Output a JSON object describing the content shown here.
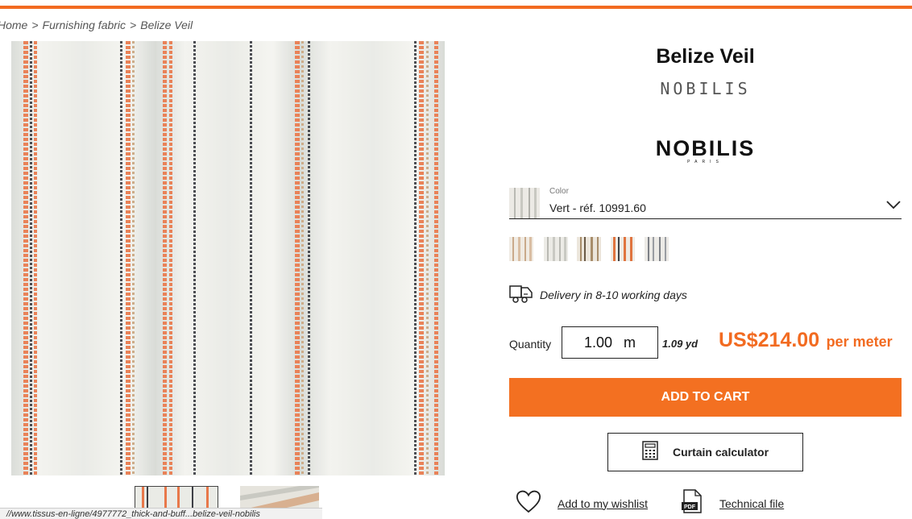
{
  "colors": {
    "accent": "#f26b21",
    "button": "#f37021",
    "price": "#f26b21"
  },
  "breadcrumb": {
    "items": [
      "Home",
      "Furnishing fabric",
      "Belize Veil"
    ],
    "separator": ">"
  },
  "product": {
    "title": "Belize Veil",
    "brand_subtitle": "NOBILIS",
    "brand_logo_name": "NOBILIS",
    "brand_logo_city": "PARIS"
  },
  "color_select": {
    "label": "Color",
    "value": "Vert - réf. 10991.60",
    "icon": "chevron-down-icon"
  },
  "swatches": [
    {
      "name": "beige",
      "stripe": "#c9a98a"
    },
    {
      "name": "vert",
      "stripe": "#b9b9b3"
    },
    {
      "name": "natural",
      "stripe": "#a88d6b"
    },
    {
      "name": "orange",
      "stripe": "#e0743f"
    },
    {
      "name": "grey",
      "stripe": "#7d8086"
    }
  ],
  "delivery": {
    "icon": "truck-icon",
    "text": "Delivery in 8-10 working days"
  },
  "quantity": {
    "label": "Quantity",
    "value": "1.00",
    "unit": "m",
    "yards": "1.09 yd"
  },
  "price": {
    "amount": "US$214.00",
    "per": "per meter"
  },
  "buttons": {
    "add_to_cart": "ADD TO CART",
    "curtain_calculator": "Curtain calculator",
    "wishlist": "Add to my wishlist",
    "technical_file": "Technical file"
  },
  "status_url": "//www.tissus-en-ligne/4977772_thick-and-buff...belize-veil-nobilis"
}
